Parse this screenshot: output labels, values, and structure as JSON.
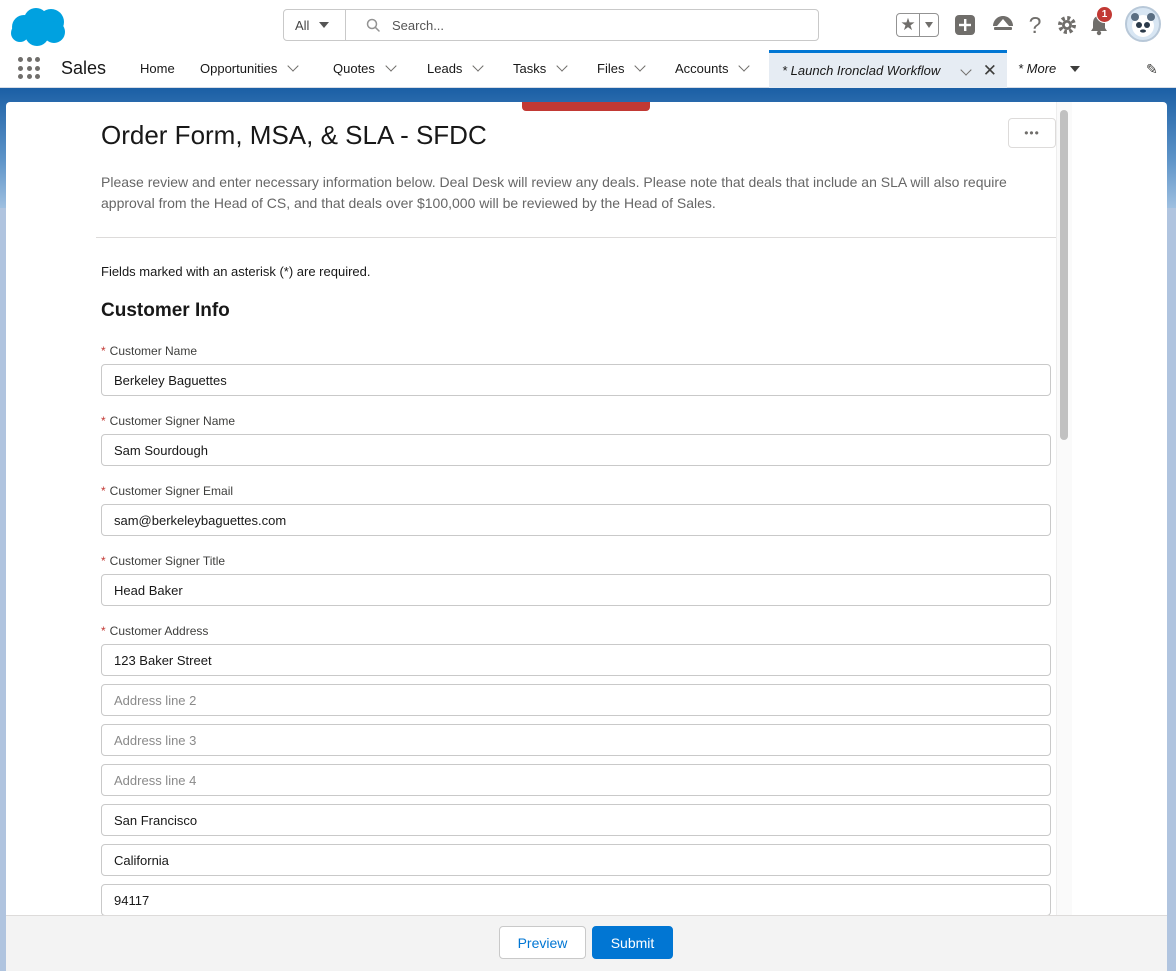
{
  "header": {
    "search_scope": "All",
    "search_placeholder": "Search...",
    "notifications_count": "1"
  },
  "nav": {
    "app_name": "Sales",
    "items": [
      {
        "label": "Home"
      },
      {
        "label": "Opportunities"
      },
      {
        "label": "Quotes"
      },
      {
        "label": "Leads"
      },
      {
        "label": "Tasks"
      },
      {
        "label": "Files"
      },
      {
        "label": "Accounts"
      }
    ],
    "active_tab": "* Launch Ironclad Workflow",
    "more_label": "* More"
  },
  "form": {
    "title": "Order Form, MSA, & SLA - SFDC",
    "description": "Please review and enter necessary information below. Deal Desk will review any deals. Please note that deals that include an SLA will also require approval from the Head of CS, and that deals over $100,000 will be reviewed by the Head of Sales.",
    "required_note": "Fields marked with an asterisk (*) are required.",
    "section_title": "Customer Info",
    "fields": {
      "customer_name": {
        "label": "Customer Name",
        "value": "Berkeley Baguettes"
      },
      "signer_name": {
        "label": "Customer Signer Name",
        "value": "Sam Sourdough"
      },
      "signer_email": {
        "label": "Customer Signer Email",
        "value": "sam@berkeleybaguettes.com"
      },
      "signer_title": {
        "label": "Customer Signer Title",
        "value": "Head Baker"
      },
      "address": {
        "label": "Customer Address",
        "line1": "123 Baker Street",
        "line2_placeholder": "Address line 2",
        "line3_placeholder": "Address line 3",
        "line4_placeholder": "Address line 4",
        "city": "San Francisco",
        "state": "California",
        "zip": "94117"
      }
    }
  },
  "footer": {
    "preview_label": "Preview",
    "submit_label": "Submit"
  },
  "colors": {
    "brand": "#0176d3",
    "required": "#c23934",
    "salesforce_cloud": "#00a1e0"
  }
}
